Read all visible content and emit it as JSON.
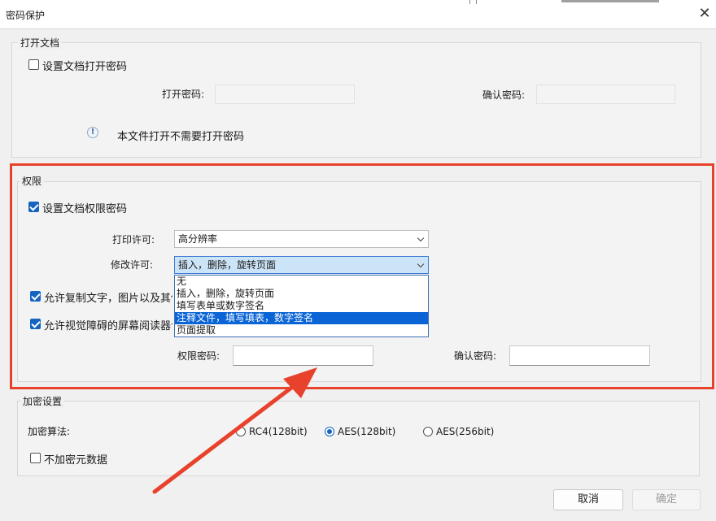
{
  "window": {
    "title": "密码保护"
  },
  "open_section": {
    "title": "打开文档",
    "require_password_label": "设置文档打开密码",
    "require_password_checked": false,
    "password_label": "打开密码:",
    "confirm_label": "确认密码:",
    "info_text": "本文件打开不需要打开密码"
  },
  "permissions": {
    "title": "权限",
    "set_password_label": "设置文档权限密码",
    "set_password_checked": true,
    "print_label": "打印许可:",
    "print_value": "高分辨率",
    "modify_label": "修改许可:",
    "modify_value": "插入，删除，旋转页面",
    "modify_options": [
      "无",
      "插入，删除，旋转页面",
      "填写表单或数字签名",
      "注释文件，填写填表，数字签名",
      "页面提取"
    ],
    "modify_highlighted_index": 3,
    "copy_label": "允许复制文字，图片以及其他",
    "copy_checked": true,
    "screen_reader_label": "允许视觉障碍的屏幕阅读器访",
    "screen_reader_checked": true,
    "password_label": "权限密码:",
    "confirm_label": "确认密码:"
  },
  "encryption": {
    "title": "加密设置",
    "algorithm_label": "加密算法:",
    "options": [
      "RC4(128bit)",
      "AES(128bit)",
      "AES(256bit)"
    ],
    "selected": "AES(128bit)",
    "no_metadata_label": "不加密元数据",
    "no_metadata_checked": false
  },
  "buttons": {
    "cancel": "取消",
    "ok": "确定"
  },
  "annotation": {
    "color": "#e8412c"
  }
}
